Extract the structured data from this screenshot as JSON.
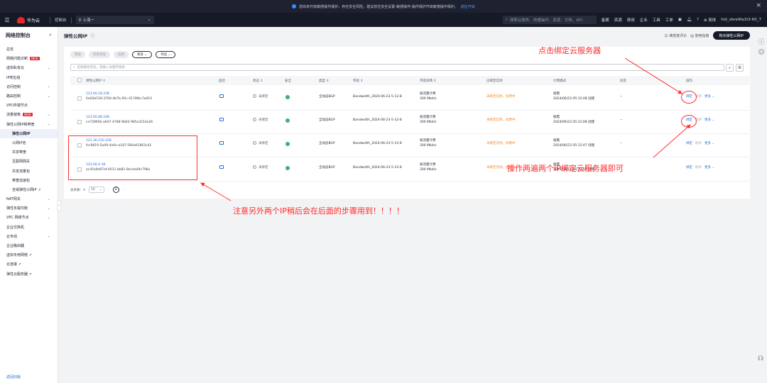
{
  "banner": {
    "text": "您尚未开启敏感操作保护，存在安全风险，建议前往安全设置-敏感操作-操作保护开启敏感操作保护。",
    "link": "前往开启"
  },
  "topnav": {
    "brand": "华为云",
    "console": "控制台",
    "region": "上海一",
    "search_placeholder": "搜索云服务、快捷操作、资源、文档、API",
    "links": [
      "备案",
      "资源",
      "费用",
      "企业",
      "工具",
      "工单"
    ],
    "lang": "简体",
    "user": "hid_xbre9fa1t3-60_7"
  },
  "sidebar": {
    "title": "网络控制台",
    "items": [
      {
        "label": "总览",
        "chev": false,
        "sub": false
      },
      {
        "label": "网络问题诊断",
        "new": "NEW",
        "chev": false,
        "sub": false
      },
      {
        "label": "虚拟私有云",
        "chev": true,
        "sub": false
      },
      {
        "label": "IP地址组",
        "chev": false,
        "sub": false
      },
      {
        "label": "访问控制",
        "chev": true,
        "sub": false
      },
      {
        "label": "路由控制",
        "chev": true,
        "sub": false
      },
      {
        "label": "VPC终端节点",
        "chev": false,
        "sub": false
      },
      {
        "label": "流量镜像",
        "new": "NEW",
        "chev": true,
        "sub": false
      },
      {
        "label": "弹性公网IP和带宽",
        "chev": true,
        "sub": false
      },
      {
        "label": "弹性公网IP",
        "active": true,
        "sub": true
      },
      {
        "label": "公网IP池",
        "sub": true
      },
      {
        "label": "共享带宽",
        "sub": true
      },
      {
        "label": "互联网网关",
        "sub": true
      },
      {
        "label": "共享流量包",
        "sub": true
      },
      {
        "label": "带宽加速包",
        "sub": true
      },
      {
        "label": "全域弹性公网IP ↗",
        "sub": true
      },
      {
        "label": "NAT网关",
        "chev": true,
        "sub": false
      },
      {
        "label": "弹性负载均衡",
        "chev": true,
        "sub": false
      },
      {
        "label": "VPC 网络节点",
        "chev": true,
        "sub": false
      },
      {
        "label": "企业交换机",
        "chev": false,
        "sub": false
      },
      {
        "label": "云专线",
        "chev": true,
        "sub": false
      },
      {
        "label": "企业路由器",
        "chev": false,
        "sub": false
      },
      {
        "label": "虚拟专用网络 ↗",
        "chev": false,
        "sub": false
      },
      {
        "label": "云连接 ↗",
        "chev": false,
        "sub": false
      },
      {
        "label": "弹性云服务器 ↗",
        "chev": false,
        "sub": false
      }
    ],
    "back": "返回旧版"
  },
  "page": {
    "title": "弹性公网IP",
    "feedback": "满意度评价",
    "guide": "使用指南",
    "buy": "购买弹性公网IP"
  },
  "toolbar": {
    "buttons": [
      "释放",
      "修改带宽",
      "续费"
    ],
    "more": "更多",
    "export": "导出"
  },
  "filter": {
    "placeholder": "选择属性筛选，或输入关键字搜索"
  },
  "table": {
    "headers": [
      "弹性公网IP ⇕",
      "监控",
      "状态 ⇕",
      "安全",
      "类型 ⇕",
      "带宽 ⇕",
      "带宽详情 ⇕",
      "已绑定实例",
      "计费模式",
      "标签",
      "操作"
    ],
    "rows": [
      {
        "ip": "123.60.18.238",
        "id": "0e02b539-3760-4b7b-95c-0178fbc7a010",
        "status": "未绑定",
        "type": "全动态BGP",
        "bw": "Bandwidth_2024-06-23-5-12-8",
        "bw1": "按流量计费",
        "bw2": "300 Mbit/s",
        "inst": "未绑定实例，扣费中",
        "bill1": "按需",
        "bill2": "2024/06/23 05:12:08 创建",
        "tag": "--",
        "op1": "绑定",
        "op2": "解绑",
        "op3": "更多"
      },
      {
        "ip": "123.60.88.168",
        "id": "ce72865b-a6d7-4788-9b62-985cd214a26",
        "status": "未绑定",
        "type": "全动态BGP",
        "bw": "Bandwidth_2024-06-23-5-12-8",
        "bw1": "按流量计费",
        "bw2": "300 Mbit/s",
        "inst": "未绑定实例，扣费中",
        "bill1": "按需",
        "bill2": "2024/06/23 05:12:08 创建",
        "tag": "--",
        "op1": "绑定",
        "op2": "解绑",
        "op3": "更多"
      },
      {
        "ip": "121.36.210.228",
        "id": "fcc9819-5a49-4e6e-a187-566a61863c42",
        "status": "未绑定",
        "type": "全动态BGP",
        "bw": "Bandwidth_2024-06-23-5-12-8",
        "bw1": "按流量计费",
        "bw2": "300 Mbit/s",
        "inst": "未绑定实例，扣费中",
        "bill1": "按需",
        "bill2": "2024/06/23 05:12:07 创建",
        "tag": "--",
        "op1": "绑定",
        "op2": "解绑",
        "op3": "更多"
      },
      {
        "ip": "123.60.4.38",
        "id": "ec45a9d07af-4011-bb81-8ecda49c798a",
        "status": "未绑定",
        "type": "全动态BGP",
        "bw": "Bandwidth_2024-06-23-5-12-8",
        "bw1": "按流量计费",
        "bw2": "300 Mbit/s",
        "inst": "未绑定实例，扣费中",
        "bill1": "按需",
        "bill2": "2024/06/23 05:12:07 创建",
        "tag": "--",
        "op1": "绑定",
        "op2": "解绑",
        "op3": "更多"
      }
    ]
  },
  "pager": {
    "total": "总条数：4",
    "size": "10",
    "page": "1"
  },
  "annotations": {
    "a1": "点击绑定云服务器",
    "a2": "操作两遍两个IP绑定云服务器即可",
    "a3": "注意另外两个IP稍后会在后面的步骤用到！！！！"
  },
  "colors": {
    "link": "#2a6edb",
    "warn": "#f5861f",
    "annot": "#ff2a2a",
    "ok": "#3fb26e"
  }
}
